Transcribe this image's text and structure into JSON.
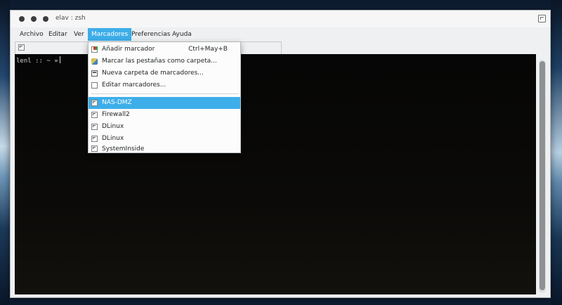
{
  "window": {
    "title": "elav : zsh"
  },
  "menubar": {
    "items": [
      "Archivo",
      "Editar",
      "Ver",
      "Marcadores",
      "Preferencias",
      "Ayuda"
    ],
    "active": "Marcadores"
  },
  "terminal": {
    "prompt": "lenl :: ~ »"
  },
  "bookmarks_menu": {
    "actions": [
      {
        "label": "Añadir marcador",
        "shortcut": "Ctrl+May+B",
        "icon": "bookmark-add-icon"
      },
      {
        "label": "Marcar las pestañas como carpeta...",
        "icon": "bookmark-tabs-icon"
      },
      {
        "label": "Nueva carpeta de marcadores...",
        "icon": "new-folder-icon"
      },
      {
        "label": "Editar marcadores...",
        "icon": "edit-bookmarks-icon"
      }
    ],
    "bookmarks": [
      {
        "label": "NAS-DMZ",
        "icon": "terminal-icon",
        "highlighted": true
      },
      {
        "label": "Firewall2",
        "icon": "terminal-icon"
      },
      {
        "label": "DLinux",
        "icon": "terminal-icon"
      },
      {
        "label": "DLinux",
        "icon": "terminal-icon"
      },
      {
        "label": "SystemInside",
        "icon": "terminal-icon"
      }
    ]
  },
  "colors": {
    "accent": "#3daee9",
    "terminal_bg": "#000000",
    "window_bg": "#eff0f1"
  }
}
